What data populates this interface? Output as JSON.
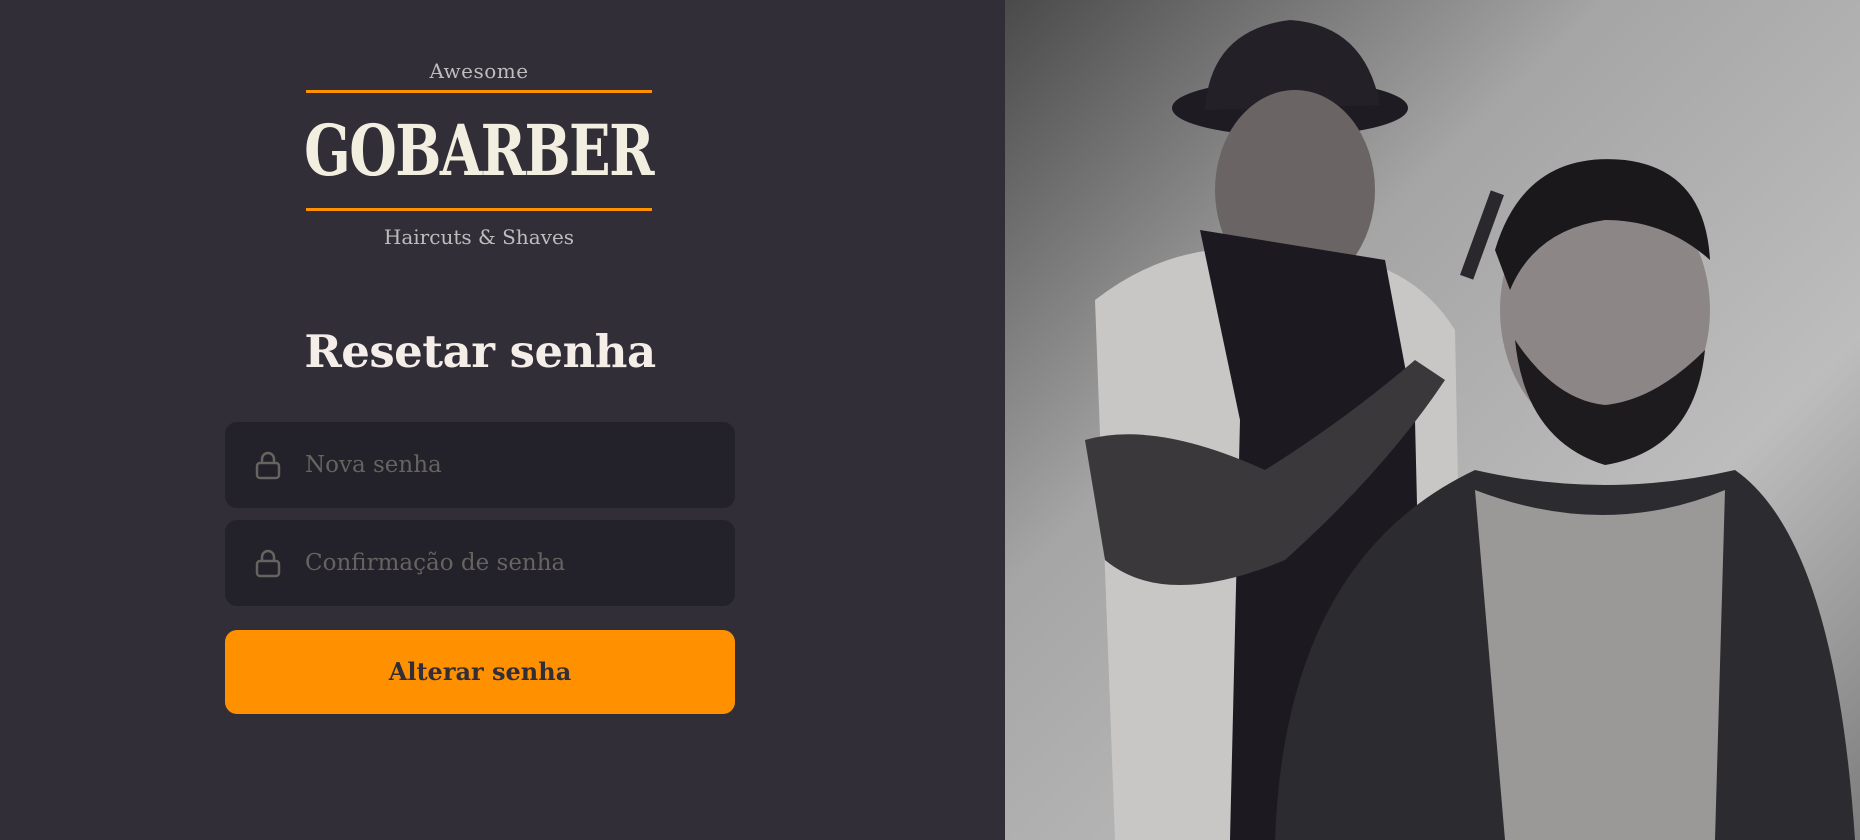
{
  "logo": {
    "top_text": "Awesome",
    "brand": "GOBARBER",
    "sub_text": "Haircuts & Shaves"
  },
  "form": {
    "title": "Resetar senha",
    "new_password_placeholder": "Nova senha",
    "confirm_password_placeholder": "Confirmação de senha",
    "submit_label": "Alterar senha"
  },
  "icons": {
    "field_icon": "lock-icon"
  },
  "colors": {
    "background": "#312e38",
    "input_background": "#232129",
    "accent": "#ff9000",
    "placeholder": "#666360",
    "text": "#f4ede8"
  }
}
